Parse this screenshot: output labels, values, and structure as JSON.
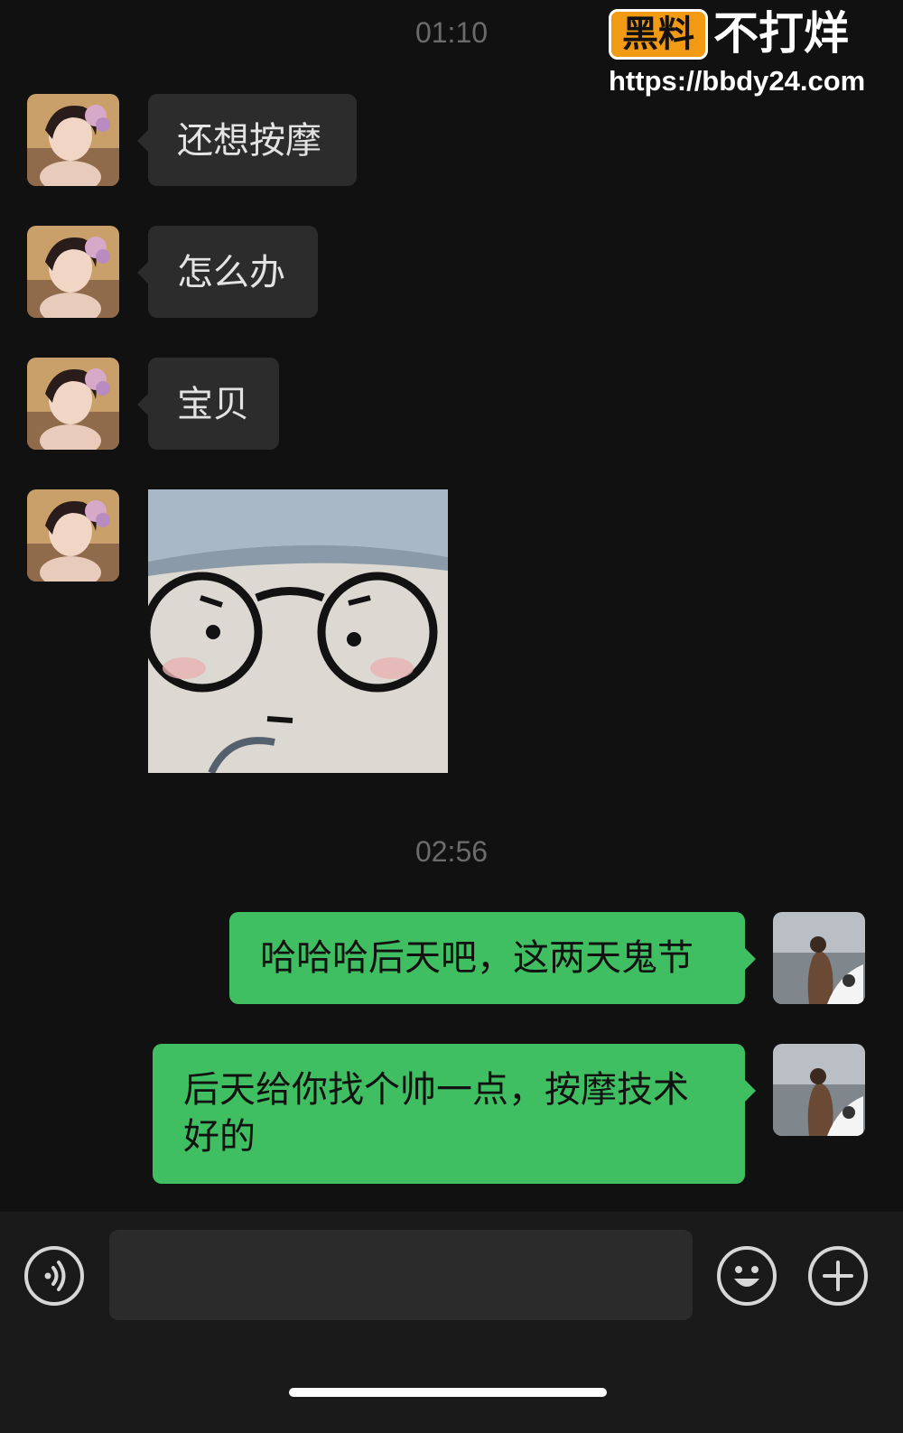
{
  "watermark": {
    "badge": "黑料",
    "text": "不打烊",
    "url": "https://bbdy24.com"
  },
  "chat": {
    "timestamp_1": "01:10",
    "incoming": [
      {
        "text": "还想按摩"
      },
      {
        "text": "怎么办"
      },
      {
        "text": "宝贝"
      }
    ],
    "sticker_name": "glasses-doll-sticker",
    "timestamp_2": "02:56",
    "outgoing": [
      {
        "text": "哈哈哈后天吧，这两天鬼节"
      },
      {
        "text": "后天给你找个帅一点，按摩技术好的"
      }
    ]
  },
  "composer": {
    "voice_icon": "voice-icon",
    "input_value": "",
    "emoji_icon": "emoji-icon",
    "plus_icon": "plus-icon"
  },
  "colors": {
    "background": "#111111",
    "incoming_bubble": "#2c2c2c",
    "outgoing_bubble": "#3fbf62",
    "badge": "#f29a14"
  }
}
